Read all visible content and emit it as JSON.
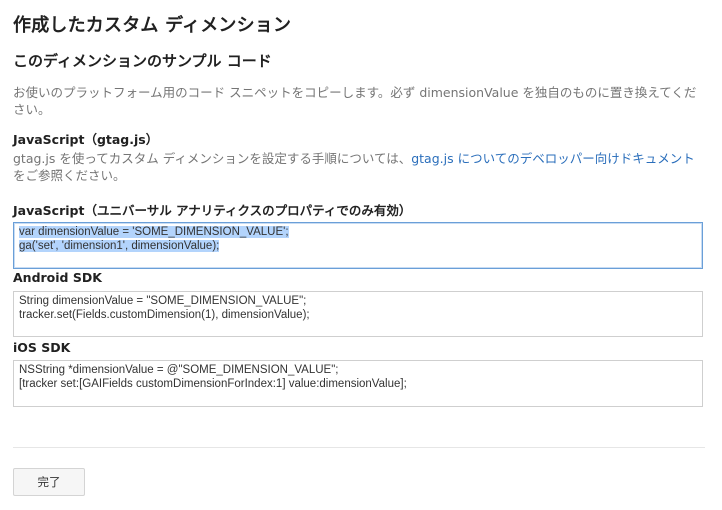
{
  "page": {
    "title": "作成したカスタム ディメンション"
  },
  "sample": {
    "heading": "このディメンションのサンプル コード",
    "intro": "お使いのプラットフォーム用のコード スニペットをコピーします。必ず dimensionValue を独自のものに置き換えてください。"
  },
  "gtag": {
    "label": "JavaScript（gtag.js）",
    "desc_before": "gtag.js を使ってカスタム ディメンションを設定する手順については、",
    "link_text": "gtag.js についてのデベロッパー向けドキュメント",
    "desc_after": "をご参照ください。"
  },
  "analytics": {
    "label": "JavaScript（ユニバーサル アナリティクスのプロパティでのみ有効）",
    "lines": [
      "var dimensionValue = 'SOME_DIMENSION_VALUE';",
      "ga('set', 'dimension1', dimensionValue);"
    ]
  },
  "android": {
    "label": "Android SDK",
    "lines": [
      "String dimensionValue = \"SOME_DIMENSION_VALUE\";",
      "tracker.set(Fields.customDimension(1), dimensionValue);"
    ]
  },
  "ios": {
    "label": "iOS SDK",
    "lines": [
      "NSString *dimensionValue = @\"SOME_DIMENSION_VALUE\";",
      "[tracker set:[GAIFields customDimensionForIndex:1] value:dimensionValue];"
    ]
  },
  "footer": {
    "done_label": "完了"
  }
}
